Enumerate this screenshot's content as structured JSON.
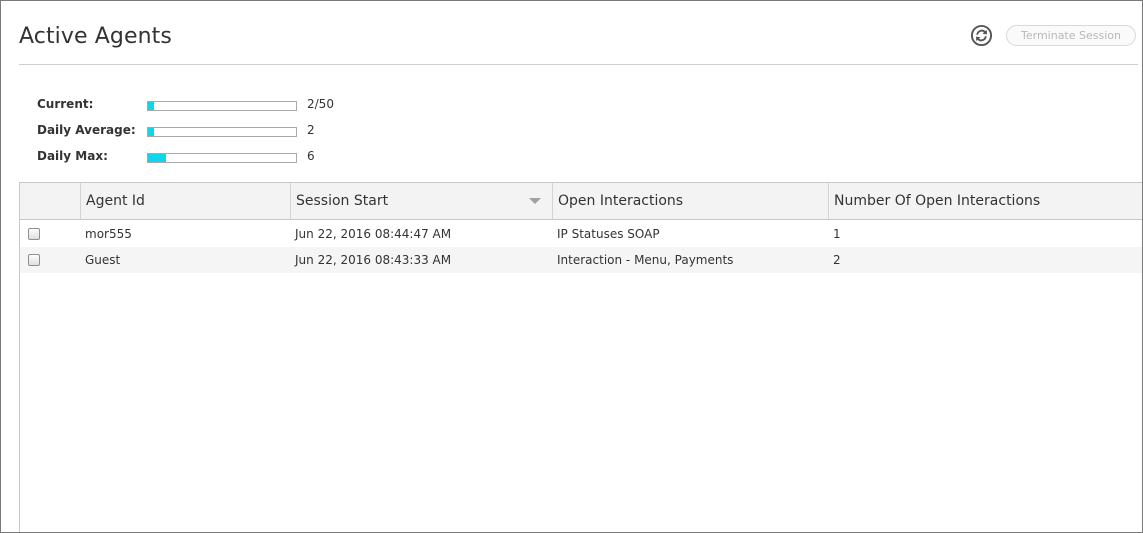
{
  "header": {
    "title": "Active Agents",
    "refresh_icon": "refresh-icon",
    "terminate_label": "Terminate Session"
  },
  "stats": [
    {
      "label": "Current:",
      "value": "2/50",
      "fill": 0.04
    },
    {
      "label": "Daily Average:",
      "value": "2",
      "fill": 0.04
    },
    {
      "label": "Daily Max:",
      "value": "6",
      "fill": 0.12
    }
  ],
  "table": {
    "columns": [
      "",
      "Agent Id",
      "Session Start",
      "Open Interactions",
      "Number Of Open Interactions"
    ],
    "sorted_column": "Session Start",
    "rows": [
      {
        "agent_id": "mor555",
        "session_start": "Jun 22, 2016 08:44:47 AM",
        "open_interactions": "IP Statuses SOAP",
        "count": "1"
      },
      {
        "agent_id": "Guest",
        "session_start": "Jun 22, 2016 08:43:33 AM",
        "open_interactions": "Interaction - Menu, Payments",
        "count": "2"
      }
    ]
  },
  "colors": {
    "bar_fill": "#12d5ea",
    "button_text_disabled": "#b8b8b8"
  }
}
